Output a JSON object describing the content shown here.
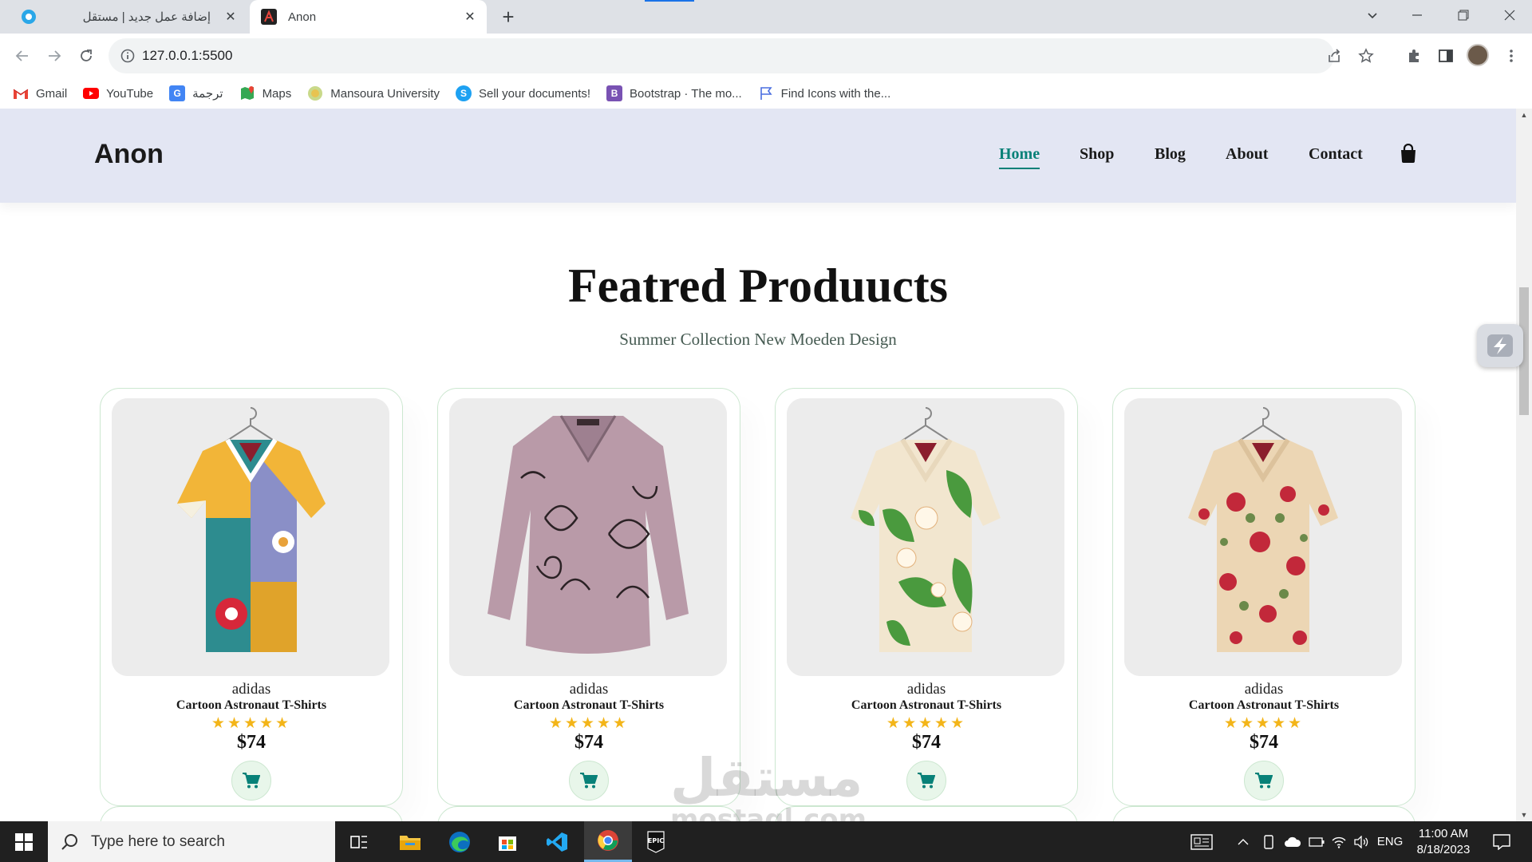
{
  "browser": {
    "tabs": [
      {
        "title": "إضافة عمل جديد | مستقل",
        "active": false
      },
      {
        "title": "Anon",
        "active": true
      }
    ],
    "url": "127.0.0.1:5500",
    "bookmarks": [
      {
        "label": "Gmail",
        "icon": "gmail-icon",
        "color": "#ea4335"
      },
      {
        "label": "YouTube",
        "icon": "youtube-icon",
        "color": "#ff0000"
      },
      {
        "label": "ترجمة",
        "icon": "translate-icon",
        "color": "#4285f4"
      },
      {
        "label": "Maps",
        "icon": "maps-icon",
        "color": "#34a853"
      },
      {
        "label": "Mansoura University",
        "icon": "university-icon",
        "color": "#8bb34a"
      },
      {
        "label": "Sell your documents!",
        "icon": "sell-docs-icon",
        "color": "#1da1f2"
      },
      {
        "label": "Bootstrap · The mo...",
        "icon": "bootstrap-icon",
        "color": "#7952b3"
      },
      {
        "label": "Find Icons with the...",
        "icon": "flag-icon",
        "color": "#4a6ee0"
      }
    ]
  },
  "site": {
    "logo": "Anon",
    "nav": [
      {
        "label": "Home",
        "active": true
      },
      {
        "label": "Shop",
        "active": false
      },
      {
        "label": "Blog",
        "active": false
      },
      {
        "label": "About",
        "active": false
      },
      {
        "label": "Contact",
        "active": false
      }
    ],
    "accent_color": "#088178",
    "header_bg": "#e3e6f3"
  },
  "products_section": {
    "title": "Featred Produucts",
    "subtitle": "Summer Collection New Moeden Design",
    "products": [
      {
        "brand": "adidas",
        "name": "Cartoon Astronaut T-Shirts",
        "stars": "★★★★★",
        "rating": 5,
        "price": "$74",
        "image": "colorful-abstract-shirt"
      },
      {
        "brand": "adidas",
        "name": "Cartoon Astronaut T-Shirts",
        "stars": "★★★★★",
        "rating": 5,
        "price": "$74",
        "image": "mauve-cat-print-blouse"
      },
      {
        "brand": "adidas",
        "name": "Cartoon Astronaut T-Shirts",
        "stars": "★★★★★",
        "rating": 5,
        "price": "$74",
        "image": "green-leaf-floral-shirt"
      },
      {
        "brand": "adidas",
        "name": "Cartoon Astronaut T-Shirts",
        "stars": "★★★★★",
        "rating": 5,
        "price": "$74",
        "image": "red-rose-floral-shirt"
      }
    ]
  },
  "watermark": {
    "arabic": "مستقل",
    "latin": "mostaql.com"
  },
  "taskbar": {
    "search_placeholder": "Type here to search",
    "language": "ENG",
    "time": "11:00 AM",
    "date": "8/18/2023"
  }
}
